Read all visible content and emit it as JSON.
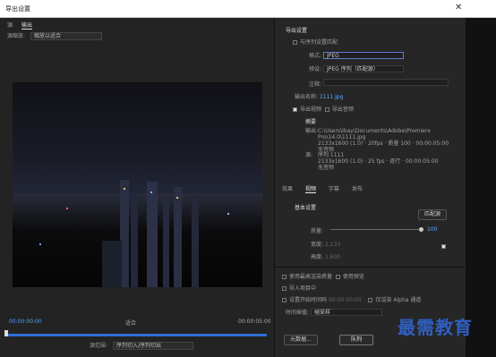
{
  "window": {
    "title": "导出设置",
    "close": "✕"
  },
  "left": {
    "tabs": [
      "源",
      "输出"
    ],
    "scale_label": "源缩放:",
    "scale_value": "缩放以适合",
    "time_start": "00:00:00:00",
    "time_end": "00:00:05:00",
    "fit": "适合",
    "range_label": "源范围:",
    "range_value": "序列切入/序列切出"
  },
  "export": {
    "section_title": "导出设置",
    "match_seq": "与序列设置匹配",
    "format_label": "格式:",
    "format_value": "JPEG",
    "preset_label": "预设:",
    "preset_value": "JPEG 序列（匹配源）",
    "comment_label": "注释:",
    "output_label": "输出名称:",
    "output_value": "1111.jpg",
    "export_video": "导出视频",
    "export_audio": "导出音频",
    "summary_title": "摘要",
    "out_label": "输出:",
    "out_lines": [
      "C:\\Users\\Ibay\\Documents\\Adobe\\Premiere Pro\\14.0\\1111.jpg",
      "2133x1600 (1.0) · 20fps · 质量 100 · 00:00:05:00",
      "无音频"
    ],
    "src_label": "源:",
    "src_lines": [
      "序列 1111",
      "2133x1600 (1.0) · 25 fps · 逐行 · 00:00:05:00",
      "无音频"
    ]
  },
  "subtabs": [
    "效果",
    "视频",
    "字幕",
    "发布"
  ],
  "basic": {
    "title": "基本设置",
    "match_btn": "匹配源",
    "quality_label": "质量:",
    "quality_value": "100",
    "width_label": "宽度:",
    "width_value": "2,133",
    "height_label": "高度:",
    "height_value": "1,600"
  },
  "bottom": {
    "max_render": "使用最高渲染质量",
    "use_preview": "使用预览",
    "import_project": "导入项目中",
    "set_start": "设置开始时间码",
    "start_tc": "00:00:00:00",
    "alpha": "仅渲染 Alpha 通道",
    "interp_label": "时间插值:",
    "interp_value": "帧采样",
    "metadata_btn": "元数据...",
    "queue_btn": "队列",
    "export_btn": "导出"
  },
  "watermark": "最需教育"
}
